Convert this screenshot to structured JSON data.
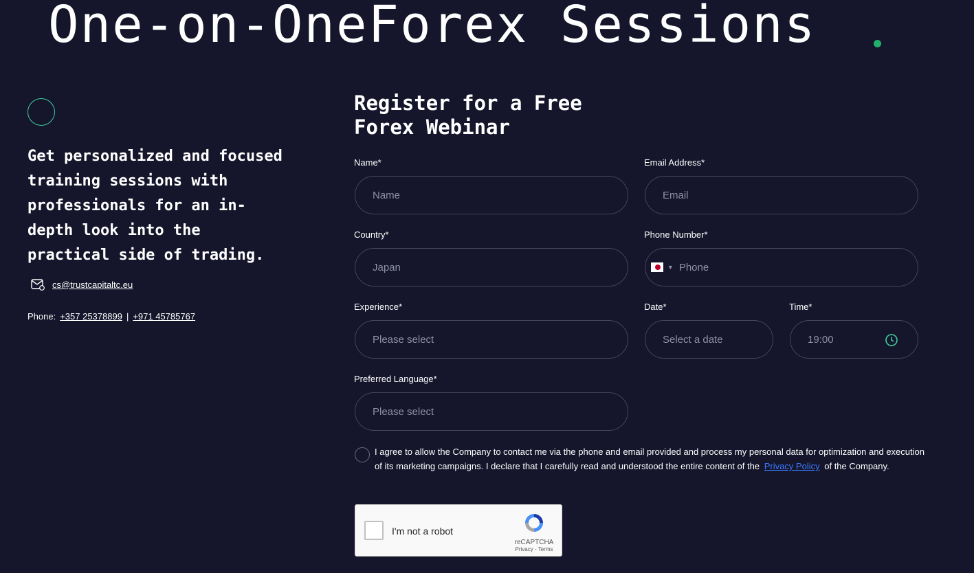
{
  "hero": {
    "title": "One-on-OneForex Sessions"
  },
  "left": {
    "tagline": "Get personalized and focused training sessions with professionals for an in-depth look into the practical side of trading.",
    "email": "cs@trustcapitaltc.eu",
    "phone_label": "Phone:",
    "phone_1": "+357 25378899",
    "phone_sep": "|",
    "phone_2": "+971 45785767"
  },
  "form": {
    "title": "Register for a Free Forex Webinar",
    "name": {
      "label": "Name*",
      "placeholder": "Name"
    },
    "email": {
      "label": "Email Address*",
      "placeholder": "Email"
    },
    "country": {
      "label": "Country*",
      "value": "Japan"
    },
    "phone": {
      "label": "Phone Number*",
      "placeholder": "Phone"
    },
    "experience": {
      "label": "Experience*",
      "placeholder": "Please select"
    },
    "date": {
      "label": "Date*",
      "placeholder": "Select a date"
    },
    "time": {
      "label": "Time*",
      "value": "19:00"
    },
    "language": {
      "label": "Preferred Language*",
      "placeholder": "Please select"
    },
    "consent": {
      "before": "I agree to allow the Company to contact me via the phone and email provided and process my personal data for optimization and execution of its marketing campaigns. I declare that I carefully read and understood the entire content of the",
      "link": "Privacy Policy",
      "after": "of the Company."
    },
    "captcha": {
      "label": "I'm not a robot",
      "brand": "reCAPTCHA",
      "terms": "Privacy - Terms"
    }
  },
  "colors": {
    "background": "#15152b",
    "accent_dot": "#22b06b",
    "ring": "#3fd0a0",
    "link": "#3b7cff"
  }
}
